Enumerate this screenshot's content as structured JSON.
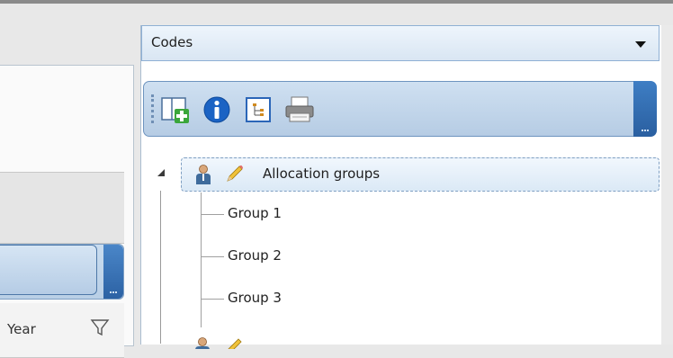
{
  "left_panel": {
    "column_header": "Year",
    "filter_icon": "filter-icon"
  },
  "codes_panel": {
    "dropdown_label": "Codes",
    "dropdown_icon": "chevron-down-icon",
    "toolbar": {
      "buttons": [
        {
          "icon": "add-window-icon"
        },
        {
          "icon": "info-icon"
        },
        {
          "icon": "tree-view-icon"
        },
        {
          "icon": "print-icon"
        }
      ]
    },
    "tree": {
      "root": {
        "label": "Allocation groups",
        "icons": [
          "person-icon",
          "pencil-icon"
        ],
        "expanded": true,
        "children": [
          {
            "label": "Group 1"
          },
          {
            "label": "Group 2"
          },
          {
            "label": "Group 3"
          }
        ]
      }
    }
  },
  "colors": {
    "accent": "#2c62a4",
    "toolbar_bg": "#c3d7ec",
    "selection_border": "#7f9fc2"
  }
}
